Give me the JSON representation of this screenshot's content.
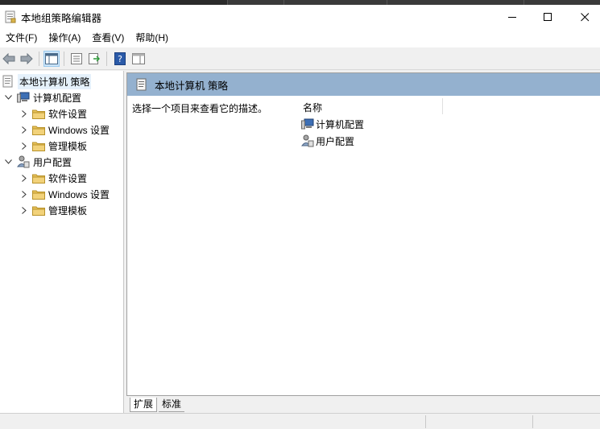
{
  "window": {
    "title": "本地组策略编辑器"
  },
  "menu": {
    "items": [
      "文件(F)",
      "操作(A)",
      "查看(V)",
      "帮助(H)"
    ]
  },
  "toolbar": {
    "buttons": [
      "back-arrow-icon",
      "forward-arrow-icon",
      "show-hide-console-tree-icon",
      "properties-icon",
      "export-list-icon",
      "help-icon",
      "show-action-pane-icon"
    ]
  },
  "tree": {
    "root": "本地计算机 策略",
    "computer_config": "计算机配置",
    "computer_children": [
      "软件设置",
      "Windows 设置",
      "管理模板"
    ],
    "user_config": "用户配置",
    "user_children": [
      "软件设置",
      "Windows 设置",
      "管理模板"
    ]
  },
  "detail": {
    "header": "本地计算机 策略",
    "description": "选择一个项目来查看它的描述。",
    "column_name": "名称",
    "items": [
      "计算机配置",
      "用户配置"
    ]
  },
  "tabs": {
    "extended": "扩展",
    "standard": "标准"
  },
  "colors": {
    "header_bg": "#94b1cf",
    "selection_bg": "#e5f1fb",
    "folder": "#e8c25a"
  }
}
